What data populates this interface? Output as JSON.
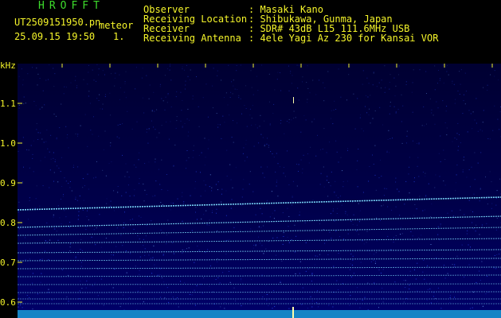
{
  "header": {
    "logo": "HROFFT",
    "filename": "UT2509151950.pn",
    "mode": "meteor",
    "datetime": "25.09.15 19:50",
    "page_num": "1.",
    "labels": {
      "observer": "Observer",
      "location": "Receiving Location",
      "receiver": "Receiver",
      "antenna": "Receiving Antenna"
    },
    "values": {
      "observer": ": Masaki Kano",
      "location": ": Shibukawa, Gunma, Japan",
      "receiver": ": SDR# 43dB L15 111.6MHz USB",
      "antenna": ": 4ele Yagi Az 230 for Kansai VOR"
    }
  },
  "axis": {
    "y_unit": "kHz",
    "y_ticks": [
      "1.1",
      "1.0",
      "0.9",
      "0.8",
      "0.7",
      "0.6"
    ],
    "x_ticks": [
      "195",
      "195",
      "195",
      "195",
      "195",
      "195",
      "195",
      "195",
      "195",
      "2000"
    ]
  },
  "colors": {
    "background": "#000000",
    "plot_background": "#00003a",
    "text": "#f5f52a",
    "logo": "#3ddc2c",
    "signal": "#7fe0ff"
  }
}
